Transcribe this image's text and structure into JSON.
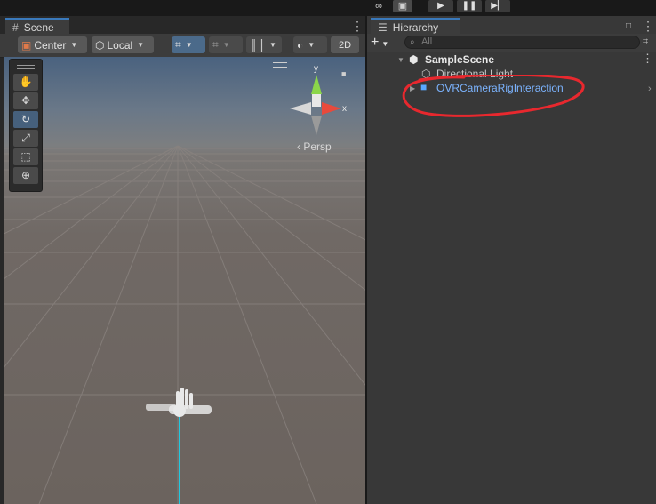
{
  "topbar": {
    "icons": [
      "cloud-services-icon",
      "collab-icon"
    ],
    "play_controls": [
      "play-icon",
      "pause-icon",
      "step-icon"
    ]
  },
  "scene": {
    "tab_label": "Scene",
    "toolbar": {
      "pivot_label": "Center",
      "space_label": "Local",
      "view2d_label": "2D"
    },
    "tools": [
      "hand-tool-icon",
      "move-tool-icon",
      "rotate-tool-icon",
      "scale-tool-icon",
      "rect-tool-icon",
      "transform-tool-icon"
    ],
    "gizmo": {
      "y_label": "y",
      "x_label": "x",
      "projection_label": "Persp"
    }
  },
  "hierarchy": {
    "tab_label": "Hierarchy",
    "search_placeholder": "All",
    "scene_name": "SampleScene",
    "items": [
      {
        "label": "Directional Light"
      },
      {
        "label": "OVRCameraRigInteraction"
      }
    ]
  },
  "colors": {
    "selected_item": "#7cb4ff",
    "annotation": "#e8282e",
    "tab_accent": "#3a79bb"
  }
}
